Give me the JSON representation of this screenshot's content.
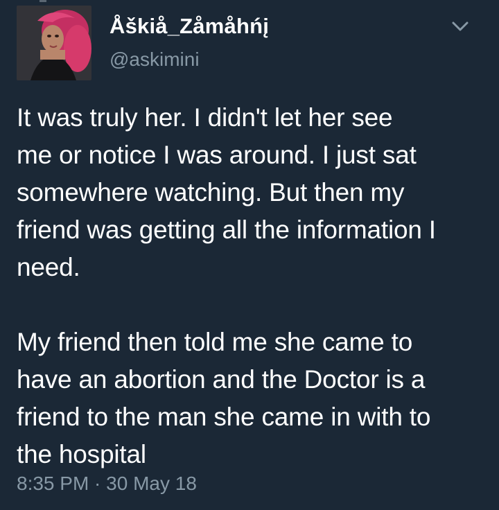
{
  "tweet": {
    "display_name": "Åškiå_Zåmåhńį",
    "handle": "@askimini",
    "text": "It was truly her. I didn't let her see\nme or notice I was around. I just sat\nsomewhere watching. But then my\nfriend was getting all the information I\nneed.\n\nMy friend then told me she came to\nhave an abortion and the Doctor is a\nfriend to the man she came in with to\nthe hospital",
    "timestamp": "8:35 PM · 30 May 18"
  },
  "icons": {
    "menu": "chevron-down-icon",
    "avatar": "avatar"
  },
  "colors": {
    "background": "#1b2836",
    "text": "#ffffff",
    "muted": "#8899a6",
    "avatar_hair": "#d63a6b"
  }
}
